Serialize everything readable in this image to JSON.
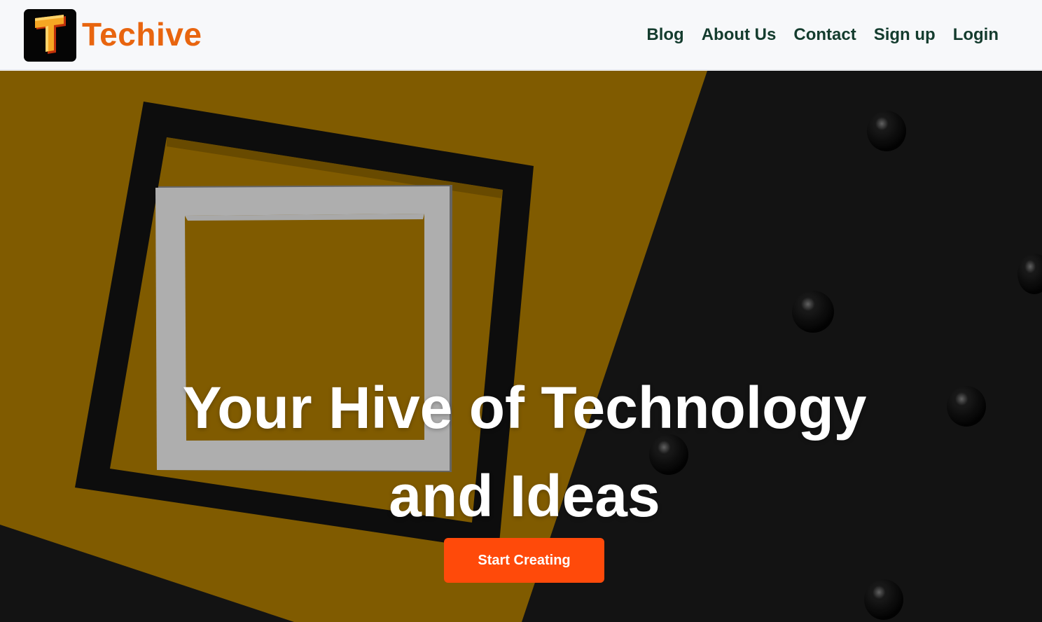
{
  "brand": {
    "name": "Techive",
    "logo_letter": "T"
  },
  "nav": {
    "items": [
      {
        "label": "Blog"
      },
      {
        "label": "About Us"
      },
      {
        "label": "Contact"
      },
      {
        "label": "Sign up"
      },
      {
        "label": "Login"
      }
    ]
  },
  "hero": {
    "title_line1": "Your Hive of Technology",
    "title_line2": "and Ideas",
    "cta_label": "Start Creating"
  },
  "colors": {
    "brand_orange": "#e8650f",
    "nav_text": "#143c2e",
    "cta_background": "#ff4a0a",
    "hero_yellow": "#8a6200",
    "hero_dark": "#141414"
  }
}
